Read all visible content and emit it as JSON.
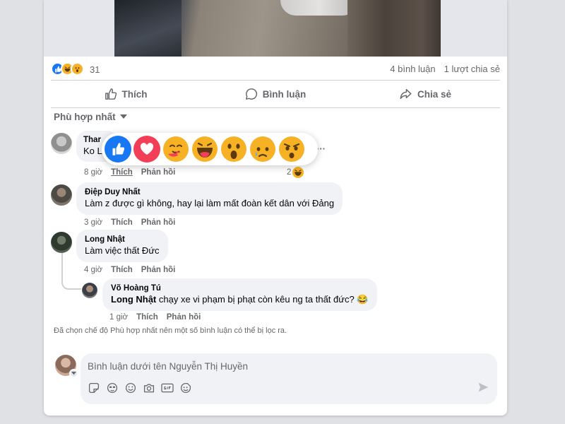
{
  "post": {
    "reaction_count": "31",
    "reaction_icons": [
      "like-icon",
      "haha-icon",
      "wow-icon"
    ],
    "comments_count": "4 bình luận",
    "shares_count": "1 lượt chia sẻ"
  },
  "actions": {
    "like": "Thích",
    "comment": "Bình luận",
    "share": "Chia sẻ"
  },
  "sort": {
    "label": "Phù hợp nhất"
  },
  "reaction_picker": [
    "like",
    "love",
    "care",
    "haha",
    "wow",
    "sad",
    "angry"
  ],
  "comments": [
    {
      "author": "Thar",
      "text": "Ko L",
      "time": "8 giờ",
      "like": "Thích",
      "reply": "Phản hồi",
      "reaction_count": "2",
      "more": "···"
    },
    {
      "author": "Điệp Duy Nhất",
      "text": "Làm z được gì không, hay lại làm mất đoàn kết dân với Đảng",
      "time": "3 giờ",
      "like": "Thích",
      "reply": "Phản hồi"
    },
    {
      "author": "Long Nhật",
      "text": "Làm việc thất Đức",
      "time": "4 giờ",
      "like": "Thích",
      "reply": "Phản hồi"
    }
  ],
  "reply": {
    "author": "Võ Hoàng Tú",
    "mention": "Long Nhật",
    "text": " chạy xe vi phạm bị phạt còn kêu ng ta thất đức? 😂",
    "time": "1 giờ",
    "like": "Thích",
    "reply": "Phản hồi"
  },
  "notice": "Đã chọn chế độ Phù hợp nhất nên một số bình luận có thể bị lọc ra.",
  "composer": {
    "placeholder": "Bình luận dưới tên Nguyễn Thị Huyền",
    "tools": [
      "sticker-icon",
      "avatar-sticker-icon",
      "emoji-icon",
      "camera-icon",
      "gif-icon",
      "sticker-face-icon"
    ]
  },
  "colors": {
    "like_blue": "#1877f2",
    "love_red": "#f33e58",
    "emoji_yellow": "#f7b125",
    "text_secondary": "#65676b",
    "bubble_bg": "#f0f2f5"
  }
}
